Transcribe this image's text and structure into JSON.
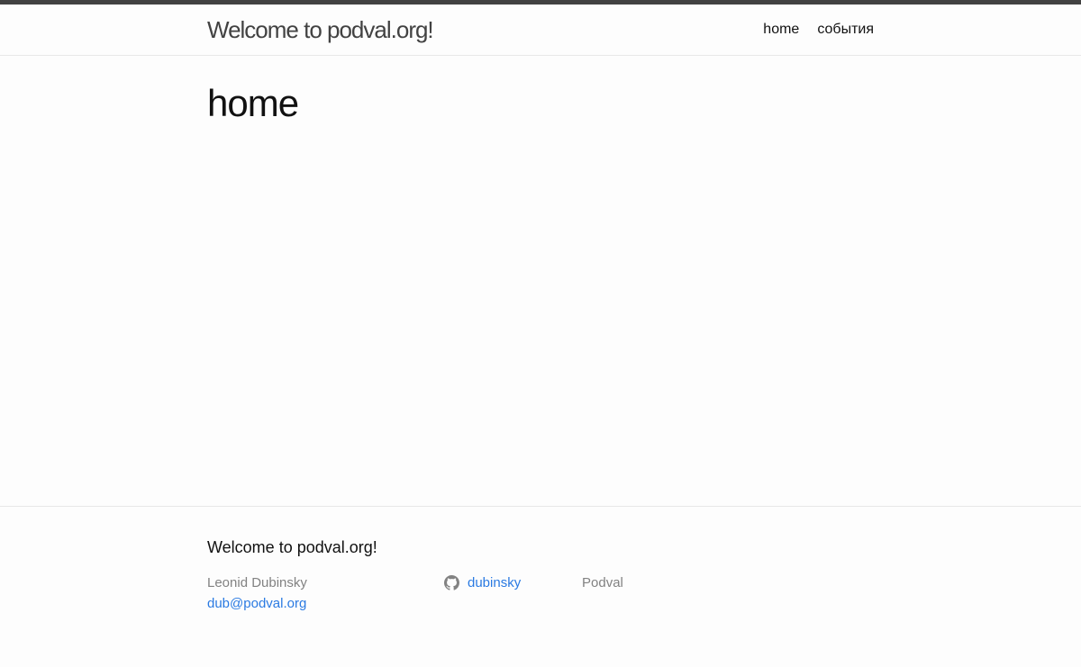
{
  "header": {
    "site_title": "Welcome to podval.org!",
    "nav": [
      {
        "label": "home"
      },
      {
        "label": "события"
      }
    ]
  },
  "main": {
    "page_title": "home"
  },
  "footer": {
    "heading": "Welcome to podval.org!",
    "author_name": "Leonid Dubinsky",
    "email": "dub@podval.org",
    "github": {
      "icon": "github-icon",
      "username": "dubinsky"
    },
    "description": "Podval"
  },
  "colors": {
    "top_bar": "#424242",
    "link": "#2a7ae2",
    "muted_text": "#828282",
    "border": "#e8e8e8",
    "background": "#fdfdfd"
  }
}
